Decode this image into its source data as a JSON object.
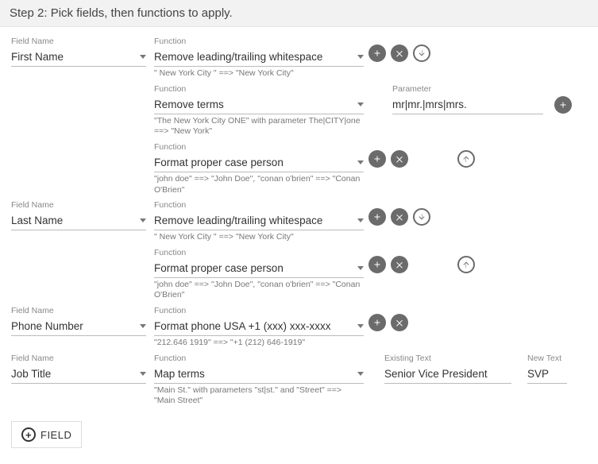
{
  "header": "Step 2: Pick fields, then functions to apply.",
  "labels": {
    "fieldName": "Field Name",
    "function": "Function",
    "parameter": "Parameter",
    "existingText": "Existing Text",
    "newText": "New Text"
  },
  "fields": [
    {
      "name": "First Name",
      "functions": [
        {
          "fn": "Remove leading/trailing whitespace",
          "example": "\" New York City \" ==> \"New York City\"",
          "icons": [
            "add",
            "remove",
            "down"
          ]
        },
        {
          "fn": "Remove terms",
          "example": "\"The New York City ONE\" with parameter The|CITY|one ==> \"New York\"",
          "param": "mr|mr.|mrs|mrs.",
          "paramIcon": true
        },
        {
          "fn": "Format proper case person",
          "example": "\"john doe\" ==> \"John Doe\", \"conan o'brien\" ==> \"Conan O'Brien\"",
          "icons": [
            "add",
            "remove",
            "",
            "up-outline"
          ]
        }
      ]
    },
    {
      "name": "Last Name",
      "functions": [
        {
          "fn": "Remove leading/trailing whitespace",
          "example": "\" New York City \" ==> \"New York City\"",
          "icons": [
            "add",
            "remove",
            "down"
          ]
        },
        {
          "fn": "Format proper case person",
          "example": "\"john doe\" ==> \"John Doe\", \"conan o'brien\" ==> \"Conan O'Brien\"",
          "icons": [
            "add",
            "remove",
            "",
            "up-outline"
          ]
        }
      ]
    },
    {
      "name": "Phone Number",
      "functions": [
        {
          "fn": "Format phone USA +1 (xxx) xxx-xxxx",
          "example": "\"212.646 1919\" ==> \"+1 (212) 646-1919\"",
          "icons": [
            "add",
            "remove"
          ]
        }
      ]
    },
    {
      "name": "Job Title",
      "functions": [
        {
          "fn": "Map terms",
          "example": "\"Main St.\" with parameters \"st|st.\" and \"Street\" ==> \"Main Street\"",
          "existingText": "Senior Vice President",
          "newText": "SVP"
        }
      ]
    }
  ],
  "addFieldButton": "FIELD"
}
